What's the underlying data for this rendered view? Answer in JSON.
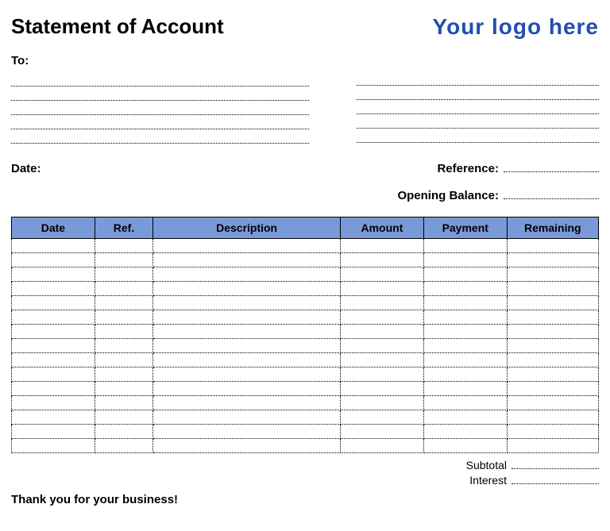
{
  "header": {
    "title": "Statement of Account",
    "logo_text": "Your logo here"
  },
  "to": {
    "label": "To:"
  },
  "meta": {
    "date_label": "Date:",
    "reference_label": "Reference:",
    "opening_balance_label": "Opening Balance:"
  },
  "table": {
    "headers": {
      "date": "Date",
      "ref": "Ref.",
      "description": "Description",
      "amount": "Amount",
      "payment": "Payment",
      "remaining": "Remaining"
    },
    "row_count": 15
  },
  "totals": {
    "subtotal_label": "Subtotal",
    "interest_label": "Interest"
  },
  "footer": {
    "thank_you": "Thank you for your business!"
  }
}
